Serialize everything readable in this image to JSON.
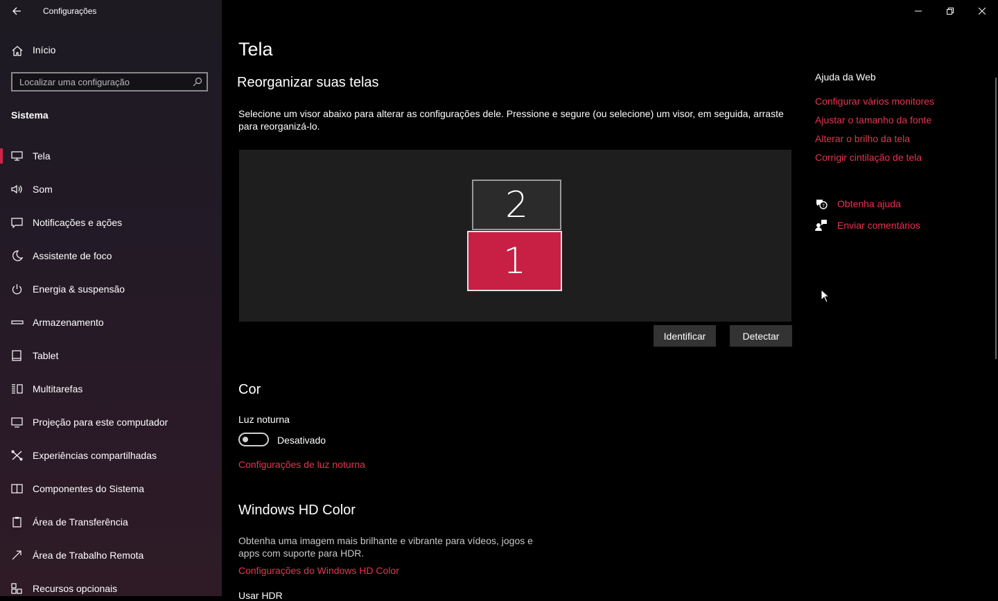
{
  "window": {
    "title": "Configurações"
  },
  "sidebar": {
    "home_label": "Início",
    "search_placeholder": "Localizar uma configuração",
    "section_label": "Sistema",
    "items": [
      {
        "label": "Tela",
        "icon": "monitor-icon",
        "active": true
      },
      {
        "label": "Som",
        "icon": "speaker-icon"
      },
      {
        "label": "Notificações e ações",
        "icon": "notification-icon"
      },
      {
        "label": "Assistente de foco",
        "icon": "moon-icon"
      },
      {
        "label": "Energia & suspensão",
        "icon": "power-icon"
      },
      {
        "label": "Armazenamento",
        "icon": "storage-icon"
      },
      {
        "label": "Tablet",
        "icon": "tablet-icon"
      },
      {
        "label": "Multitarefas",
        "icon": "multitask-icon"
      },
      {
        "label": "Projeção para este computador",
        "icon": "projection-icon"
      },
      {
        "label": "Experiências compartilhadas",
        "icon": "shared-icon"
      },
      {
        "label": "Componentes do Sistema",
        "icon": "components-icon"
      },
      {
        "label": "Área de Transferência",
        "icon": "clipboard-icon"
      },
      {
        "label": "Área de Trabalho Remota",
        "icon": "remote-icon"
      },
      {
        "label": "Recursos opcionais",
        "icon": "features-icon"
      }
    ]
  },
  "main": {
    "title": "Tela",
    "rearrange_heading": "Reorganizar suas telas",
    "rearrange_desc": "Selecione um visor abaixo para alterar as configurações dele. Pressione e segure (ou selecione) um visor, em seguida, arraste para reorganizá-lo.",
    "monitor_1": "1",
    "monitor_2": "2",
    "identify_button": "Identificar",
    "detect_button": "Detectar",
    "color_heading": "Cor",
    "night_light_label": "Luz noturna",
    "night_light_state": "Desativado",
    "night_light_link": "Configurações de luz noturna",
    "hdr_heading": "Windows HD Color",
    "hdr_desc": "Obtenha uma imagem mais brilhante e vibrante para vídeos, jogos e apps com suporte para HDR.",
    "hdr_link": "Configurações do Windows HD Color",
    "hdr_cut_text": "Usar HDR"
  },
  "help": {
    "title": "Ajuda da Web",
    "links": [
      "Configurar vários monitores",
      "Ajustar o tamanho da fonte",
      "Alterar o brilho da tela",
      "Corrigir cintilação de tela"
    ],
    "get_help": "Obtenha ajuda",
    "feedback": "Enviar comentários"
  },
  "colors": {
    "accent": "#e8344f",
    "selected_monitor": "#c81f45"
  }
}
